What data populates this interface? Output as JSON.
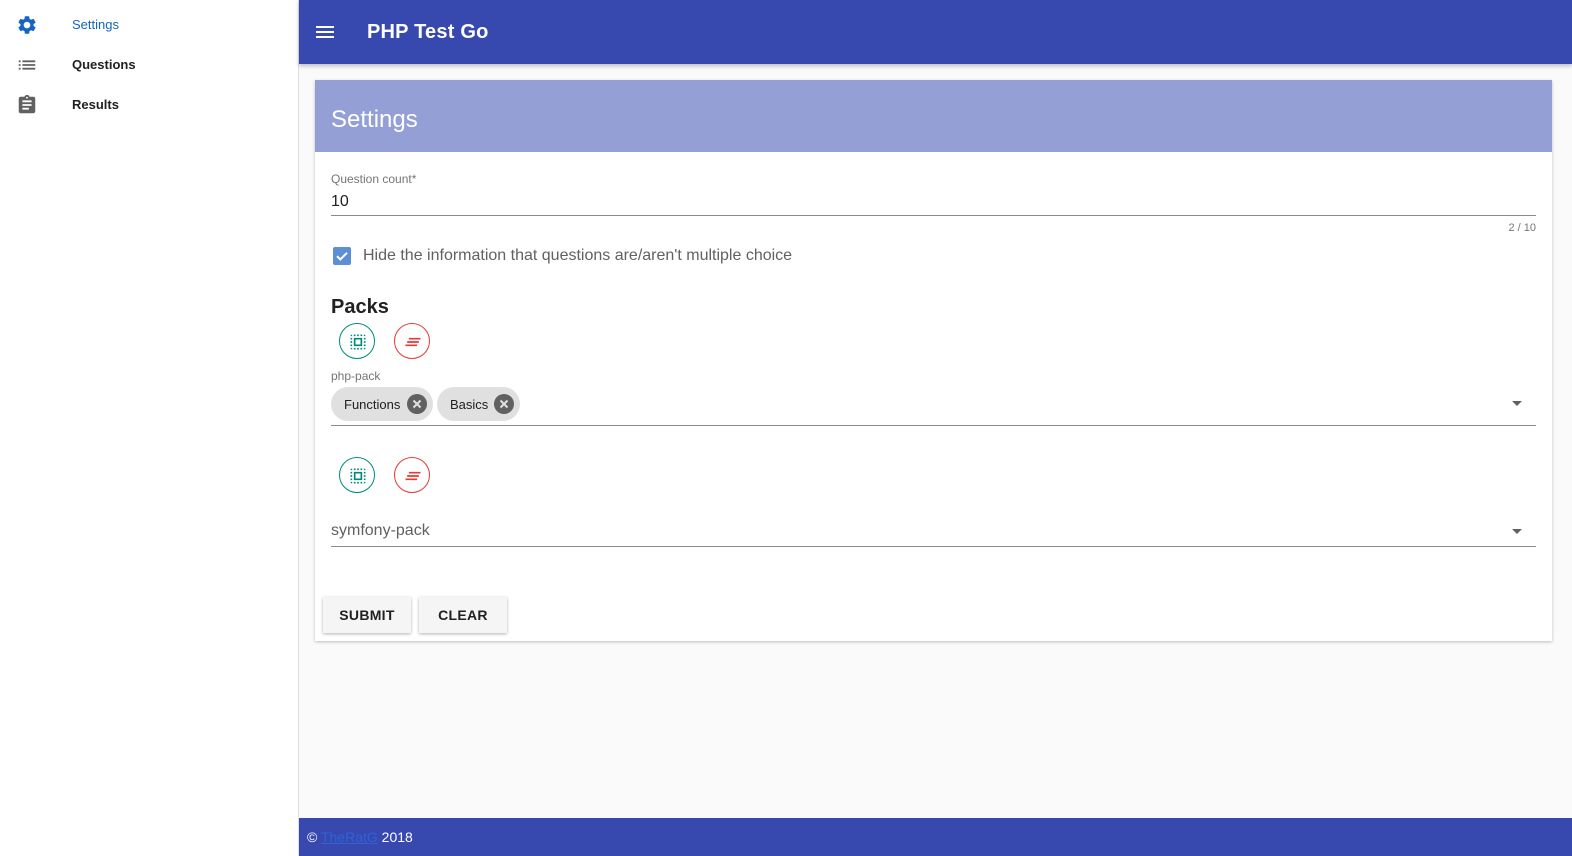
{
  "sidebar": {
    "items": [
      {
        "label": "Settings",
        "icon": "gear-icon",
        "active": true
      },
      {
        "label": "Questions",
        "icon": "list-icon",
        "active": false
      },
      {
        "label": "Results",
        "icon": "clipboard-icon",
        "active": false
      }
    ]
  },
  "header": {
    "title": "PHP Test Go",
    "menu_icon": "hamburger-menu-icon"
  },
  "settings": {
    "title": "Settings",
    "question_count": {
      "label": "Question count*",
      "value": "10",
      "counter": "2 / 10"
    },
    "hide_multiple_choice": {
      "checked": true,
      "label": "Hide the information that questions are/aren't multiple choice"
    },
    "packs_title": "Packs",
    "packs": [
      {
        "label": "php-pack",
        "chips": [
          "Functions",
          "Basics"
        ],
        "select_all_icon": "select-all-icon",
        "clear_icon": "clear-all-icon"
      },
      {
        "label": "symfony-pack",
        "chips": [],
        "select_all_icon": "select-all-icon",
        "clear_icon": "clear-all-icon"
      }
    ],
    "submit_label": "SUBMIT",
    "clear_label": "CLEAR"
  },
  "footer": {
    "copyright": "©",
    "author": "TheRatG",
    "year": "2018"
  },
  "colors": {
    "primary": "#3748af",
    "card_header": "#949fd6",
    "active_nav": "#1565c0",
    "checkbox": "#5c8fd6",
    "green_action": "#00897b",
    "red_action": "#e53935"
  }
}
